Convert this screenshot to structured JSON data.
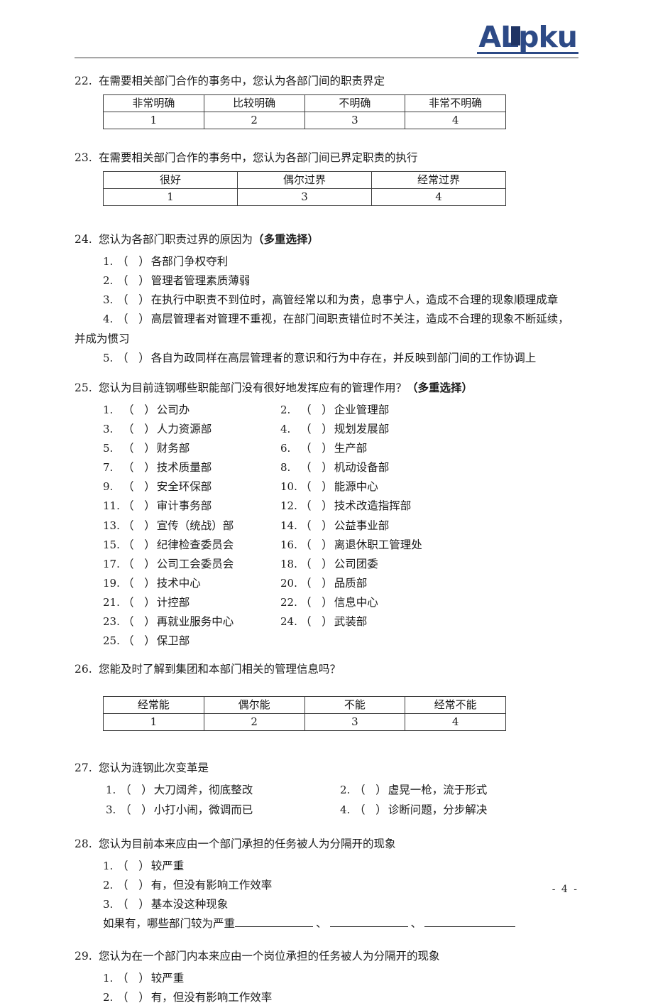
{
  "header": {
    "logo_text": "ALpku",
    "logo_color": "#2d4a86"
  },
  "questions": [
    {
      "number": "22.",
      "text": "在需要相关部门合作的事务中，您认为各部门间的职责界定",
      "table": {
        "headers": [
          "非常明确",
          "比较明确",
          "不明确",
          "非常不明确"
        ],
        "values": [
          "1",
          "2",
          "3",
          "4"
        ]
      }
    },
    {
      "number": "23.",
      "text": "在需要相关部门合作的事务中，您认为各部门间已界定职责的执行",
      "table": {
        "headers": [
          "很好",
          "偶尔过界",
          "经常过界"
        ],
        "values": [
          "1",
          "3",
          "4"
        ]
      }
    },
    {
      "number": "24.",
      "text": "您认为各部门职责过界的原因为",
      "text_bold": "（多重选择）",
      "options": [
        {
          "idx": "1.",
          "label": "各部门争权夺利"
        },
        {
          "idx": "2.",
          "label": "管理者管理素质薄弱"
        },
        {
          "idx": "3.",
          "label": "在执行中职责不到位时，高管经常以和为贵，息事宁人，造成不合理的现象顺理成章"
        },
        {
          "idx": "4.",
          "label": "高层管理者对管理不重视，在部门间职责错位时不关注，造成不合理的现象不断延续，",
          "continuation": "并成为惯习"
        },
        {
          "idx": "5.",
          "label": "各自为政同样在高层管理者的意识和行为中存在，并反映到部门间的工作协调上"
        }
      ]
    },
    {
      "number": "25.",
      "text": "您认为目前涟钢哪些职能部门没有很好地发挥应有的管理作用？",
      "text_bold": "（多重选择）",
      "departments": [
        {
          "idx": "1.",
          "label": "公司办"
        },
        {
          "idx": "2.",
          "label": "企业管理部"
        },
        {
          "idx": "3.",
          "label": "人力资源部"
        },
        {
          "idx": "4.",
          "label": "规划发展部"
        },
        {
          "idx": "5.",
          "label": "财务部"
        },
        {
          "idx": "6.",
          "label": "生产部"
        },
        {
          "idx": "7.",
          "label": "技术质量部"
        },
        {
          "idx": "8.",
          "label": "机动设备部"
        },
        {
          "idx": "9.",
          "label": "安全环保部"
        },
        {
          "idx": "10.",
          "label": "能源中心"
        },
        {
          "idx": "11.",
          "label": "审计事务部"
        },
        {
          "idx": "12.",
          "label": "技术改造指挥部"
        },
        {
          "idx": "13.",
          "label": "宣传（统战）部"
        },
        {
          "idx": "14.",
          "label": "公益事业部"
        },
        {
          "idx": "15.",
          "label": "纪律检查委员会"
        },
        {
          "idx": "16.",
          "label": "离退休职工管理处"
        },
        {
          "idx": "17.",
          "label": "公司工会委员会"
        },
        {
          "idx": "18.",
          "label": "公司团委"
        },
        {
          "idx": "19.",
          "label": "技术中心"
        },
        {
          "idx": "20.",
          "label": "品质部"
        },
        {
          "idx": "21.",
          "label": "计控部"
        },
        {
          "idx": "22.",
          "label": "信息中心"
        },
        {
          "idx": "23.",
          "label": "再就业服务中心"
        },
        {
          "idx": "24.",
          "label": "武装部"
        },
        {
          "idx": "25.",
          "label": "保卫部"
        }
      ]
    },
    {
      "number": "26.",
      "text": "您能及时了解到集团和本部门相关的管理信息吗？",
      "table": {
        "headers": [
          "经常能",
          "偶尔能",
          "不能",
          "经常不能"
        ],
        "values": [
          "1",
          "2",
          "3",
          "4"
        ]
      }
    },
    {
      "number": "27.",
      "text": "您认为涟钢此次变革是",
      "options": [
        {
          "idx": "1.",
          "label": "大刀阔斧，彻底整改"
        },
        {
          "idx": "2.",
          "label": "虚晃一枪，流于形式"
        },
        {
          "idx": "3.",
          "label": "小打小闹，微调而已"
        },
        {
          "idx": "4.",
          "label": "诊断问题，分步解决"
        }
      ]
    },
    {
      "number": "28.",
      "text": "您认为目前本来应由一个部门承担的任务被人为分隔开的现象",
      "options": [
        {
          "idx": "1.",
          "label": "较严重"
        },
        {
          "idx": "2.",
          "label": "有，但没有影响工作效率"
        },
        {
          "idx": "3.",
          "label": "基本没这种现象"
        }
      ],
      "fill_prompt": "如果有，哪些部门较为严重",
      "fill_separator": "、"
    },
    {
      "number": "29.",
      "text": "您认为在一个部门内本来应由一个岗位承担的任务被人为分隔开的现象",
      "options": [
        {
          "idx": "1.",
          "label": "较严重"
        },
        {
          "idx": "2.",
          "label": "有，但没有影响工作效率"
        }
      ]
    }
  ],
  "footer": {
    "page_label": "- 4 -"
  }
}
